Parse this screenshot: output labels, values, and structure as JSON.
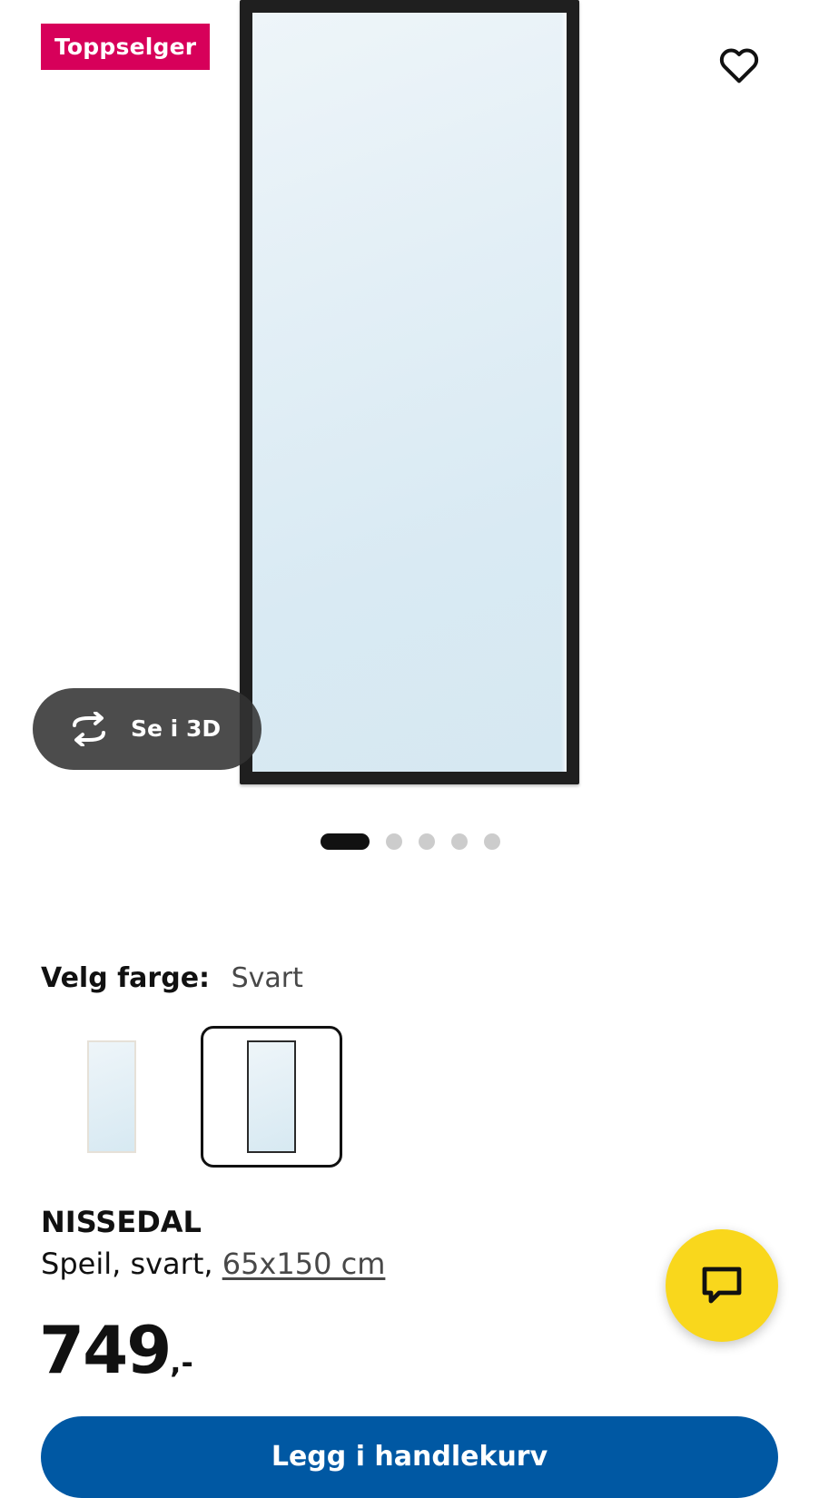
{
  "gallery": {
    "badge": "Toppselger",
    "view3d_label": "Se i 3D",
    "slide_count": 5,
    "active_slide": 1
  },
  "color_selection": {
    "label": "Velg farge:",
    "selected_value": "Svart",
    "swatches": [
      {
        "name": "Hvit",
        "selected": false
      },
      {
        "name": "Svart",
        "selected": true
      }
    ]
  },
  "product": {
    "name": "NISSEDAL",
    "description": "Speil, svart, ",
    "size": "65x150 cm",
    "price_integer": "749",
    "price_suffix": ",-"
  },
  "actions": {
    "add_to_cart_label": "Legg i handlekurv"
  },
  "colors": {
    "badge": "#d7005a",
    "chat_fab": "#f9d71c",
    "primary_button": "#0058a3",
    "mirror_frame": "#1f1f1f"
  },
  "icons": {
    "favorite": "heart-icon",
    "view3d": "rotate-3d-icon",
    "chat": "chat-bubble-icon"
  }
}
